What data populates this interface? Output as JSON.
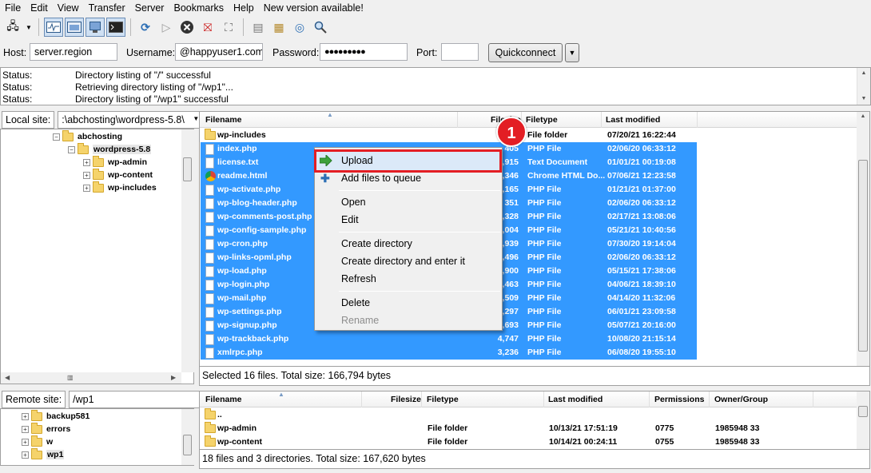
{
  "menu": [
    "File",
    "Edit",
    "View",
    "Transfer",
    "Server",
    "Bookmarks",
    "Help",
    "New version available!"
  ],
  "toolbar_icons": [
    "site-manager-icon",
    "dropdown-arrow-icon",
    "toggle-log-icon",
    "toggle-local-tree-icon",
    "toggle-remote-tree-icon",
    "toggle-queue-icon",
    "refresh-icon",
    "process-queue-icon",
    "cancel-icon",
    "disconnect-icon",
    "reconnect-icon",
    "filter-icon",
    "compare-icon",
    "sync-browse-icon",
    "search-icon"
  ],
  "quickconnect": {
    "host_label": "Host:",
    "host_value": "server.region",
    "user_label": "Username:",
    "user_value": "@happyuser1.com",
    "pass_label": "Password:",
    "pass_value": "●●●●●●●●●",
    "port_label": "Port:",
    "port_value": "",
    "button": "Quickconnect"
  },
  "log": [
    {
      "status": "Status:",
      "msg": "Directory listing of \"/\" successful"
    },
    {
      "status": "Status:",
      "msg": "Retrieving directory listing of \"/wp1\"..."
    },
    {
      "status": "Status:",
      "msg": "Directory listing of \"/wp1\" successful"
    }
  ],
  "local": {
    "label": "Local site:",
    "path": ":\\abchosting\\wordpress-5.8\\",
    "tree": [
      {
        "name": "abchosting",
        "expander": "−"
      },
      {
        "name": "wordpress-5.8",
        "expander": "−"
      },
      {
        "name": "wp-admin",
        "expander": "+"
      },
      {
        "name": "wp-content",
        "expander": "+"
      },
      {
        "name": "wp-includes",
        "expander": "+"
      }
    ],
    "headers": {
      "filename": "Filename",
      "filesize": "Filesize",
      "filetype": "Filetype",
      "modified": "Last modified"
    },
    "files": [
      {
        "name": "wp-includes",
        "size": "",
        "type": "File folder",
        "date": "07/20/21 16:22:44",
        "sel": false,
        "icon": "folder"
      },
      {
        "name": "index.php",
        "size": "405",
        "type": "PHP File",
        "date": "02/06/20 06:33:12",
        "sel": true,
        "icon": "file"
      },
      {
        "name": "license.txt",
        "size": "19,915",
        "type": "Text Document",
        "date": "01/01/21 00:19:08",
        "sel": true,
        "icon": "file"
      },
      {
        "name": "readme.html",
        "size": "7,346",
        "type": "Chrome HTML Do...",
        "date": "07/06/21 12:23:58",
        "sel": true,
        "icon": "chrome"
      },
      {
        "name": "wp-activate.php",
        "size": "7,165",
        "type": "PHP File",
        "date": "01/21/21 01:37:00",
        "sel": true,
        "icon": "file"
      },
      {
        "name": "wp-blog-header.php",
        "size": "351",
        "type": "PHP File",
        "date": "02/06/20 06:33:12",
        "sel": true,
        "icon": "file"
      },
      {
        "name": "wp-comments-post.php",
        "size": "2,328",
        "type": "PHP File",
        "date": "02/17/21 13:08:06",
        "sel": true,
        "icon": "file"
      },
      {
        "name": "wp-config-sample.php",
        "size": "3,004",
        "type": "PHP File",
        "date": "05/21/21 10:40:56",
        "sel": true,
        "icon": "file"
      },
      {
        "name": "wp-cron.php",
        "size": "3,939",
        "type": "PHP File",
        "date": "07/30/20 19:14:04",
        "sel": true,
        "icon": "file"
      },
      {
        "name": "wp-links-opml.php",
        "size": "2,496",
        "type": "PHP File",
        "date": "02/06/20 06:33:12",
        "sel": true,
        "icon": "file"
      },
      {
        "name": "wp-load.php",
        "size": "3,900",
        "type": "PHP File",
        "date": "05/15/21 17:38:06",
        "sel": true,
        "icon": "file"
      },
      {
        "name": "wp-login.php",
        "size": "45,463",
        "type": "PHP File",
        "date": "04/06/21 18:39:10",
        "sel": true,
        "icon": "file"
      },
      {
        "name": "wp-mail.php",
        "size": "8,509",
        "type": "PHP File",
        "date": "04/14/20 11:32:06",
        "sel": true,
        "icon": "file"
      },
      {
        "name": "wp-settings.php",
        "size": "21,297",
        "type": "PHP File",
        "date": "06/01/21 23:09:58",
        "sel": true,
        "icon": "file"
      },
      {
        "name": "wp-signup.php",
        "size": "31,693",
        "type": "PHP File",
        "date": "05/07/21 20:16:00",
        "sel": true,
        "icon": "file"
      },
      {
        "name": "wp-trackback.php",
        "size": "4,747",
        "type": "PHP File",
        "date": "10/08/20 21:15:14",
        "sel": true,
        "icon": "file"
      },
      {
        "name": "xmlrpc.php",
        "size": "3,236",
        "type": "PHP File",
        "date": "06/08/20 19:55:10",
        "sel": true,
        "icon": "file"
      }
    ],
    "status": "Selected 16 files. Total size: 166,794 bytes"
  },
  "context_menu": {
    "items": [
      "Upload",
      "Add files to queue",
      "Open",
      "Edit",
      "Create directory",
      "Create directory and enter it",
      "Refresh",
      "Delete",
      "Rename"
    ],
    "highlight_color": "#e31e24"
  },
  "callout": "1",
  "remote": {
    "label": "Remote site:",
    "path": "/wp1",
    "tree": [
      {
        "name": "backup581",
        "expander": "+"
      },
      {
        "name": "errors",
        "expander": "+"
      },
      {
        "name": "w",
        "expander": "+"
      },
      {
        "name": "wp1",
        "expander": "+"
      }
    ],
    "headers": {
      "filename": "Filename",
      "filesize": "Filesize",
      "filetype": "Filetype",
      "modified": "Last modified",
      "perms": "Permissions",
      "owner": "Owner/Group"
    },
    "files": [
      {
        "name": "..",
        "type": "",
        "date": "",
        "perms": "",
        "owner": ""
      },
      {
        "name": "wp-admin",
        "type": "File folder",
        "date": "10/13/21 17:51:19",
        "perms": "0775",
        "owner": "1985948 33"
      },
      {
        "name": "wp-content",
        "type": "File folder",
        "date": "10/14/21 00:24:11",
        "perms": "0755",
        "owner": "1985948 33"
      }
    ],
    "status": "18 files and 3 directories. Total size: 167,620 bytes"
  },
  "colors": {
    "selection": "#3399ff",
    "callout": "#e31e24"
  }
}
